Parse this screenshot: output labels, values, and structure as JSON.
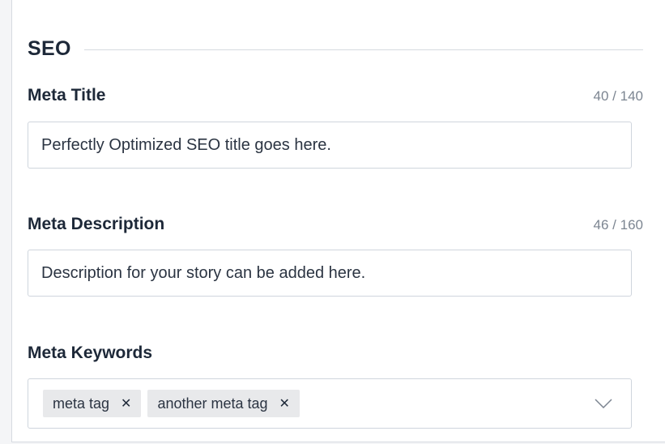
{
  "seo_section": {
    "title": "SEO"
  },
  "meta_title": {
    "label": "Meta Title",
    "counter": "40 / 140",
    "value": "Perfectly Optimized SEO title goes here."
  },
  "meta_description": {
    "label": "Meta Description",
    "counter": "46 / 160",
    "value": "Description for your story can be added here."
  },
  "meta_keywords": {
    "label": "Meta Keywords",
    "tags": [
      {
        "label": "meta tag",
        "remove_icon": "close-icon"
      },
      {
        "label": "another meta tag",
        "remove_icon": "close-icon"
      }
    ],
    "dropdown_icon": "chevron-down-icon"
  },
  "colors": {
    "text_primary": "#1d2838",
    "text_muted": "#7c8591",
    "border": "#cfd5dd",
    "tag_bg": "#e8e9eb"
  }
}
